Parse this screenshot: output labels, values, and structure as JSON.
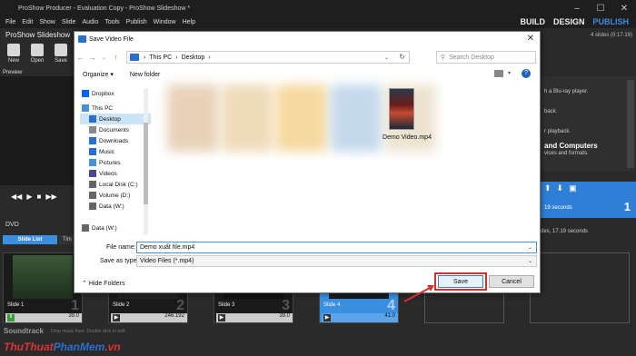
{
  "app": {
    "title": "ProShow Producer - Evaluation Copy - ProShow Slideshow *",
    "name": "ProShow Slideshow",
    "slide_info": "4 slides (0:17.19)",
    "menu": [
      "File",
      "Edit",
      "Show",
      "Slide",
      "Audio",
      "Tools",
      "Publish",
      "Window",
      "Help"
    ],
    "modes": [
      "BUILD",
      "DESIGN",
      "PUBLISH"
    ],
    "active_mode": "PUBLISH",
    "toolbar": [
      {
        "label": "New",
        "icon": "new-file-icon"
      },
      {
        "label": "Open",
        "icon": "open-folder-icon"
      },
      {
        "label": "Save",
        "icon": "save-disk-icon"
      }
    ],
    "preview_label": "Preview",
    "dvd_label": "DVD",
    "tab_slide_list": "Slide List",
    "tab_timeline": "Tim",
    "right_panel": {
      "line1": "h a Blu-ray player.",
      "line2": "back.",
      "line3": "r playback.",
      "heading": "and Computers",
      "line4": "vices and formats."
    },
    "blue_box_text": "19 seconds",
    "blue_box_num": "1",
    "slides_total": "des, 17.19 seconds",
    "slides": [
      {
        "label": "Slide 1",
        "num": "1",
        "duration": "39.0",
        "thumb_color": "#3c5a3a"
      },
      {
        "label": "Slide 2",
        "num": "2",
        "duration": "246.192",
        "thumb_color": "#2c2c2c"
      },
      {
        "label": "Slide 3",
        "num": "3",
        "duration": "39.0",
        "thumb_color": "#1e1e1e"
      },
      {
        "label": "Slide 4",
        "num": "4",
        "duration": "41.0",
        "thumb_color": "#20252d"
      }
    ],
    "soundtrack": "Soundtrack",
    "soundtrack_hint": "Drop music here. Double click to edit.",
    "watermark_a": "ThuThuat",
    "watermark_b": "PhanMem",
    "watermark_c": ".vn"
  },
  "dialog": {
    "title": "Save Video File",
    "path": [
      "This PC",
      "Desktop"
    ],
    "search_placeholder": "Search Desktop",
    "organize": "Organize",
    "new_folder": "New folder",
    "nav_items": [
      {
        "label": "Dropbox",
        "icon": "dropbox-icon",
        "color": "#0061fe"
      },
      {
        "label": "This PC",
        "icon": "computer-icon",
        "color": "#4a90d9"
      },
      {
        "label": "Desktop",
        "icon": "desktop-icon",
        "color": "#2a6fd0"
      },
      {
        "label": "Documents",
        "icon": "documents-icon",
        "color": "#8a8a8a"
      },
      {
        "label": "Downloads",
        "icon": "downloads-icon",
        "color": "#2a6fd0"
      },
      {
        "label": "Music",
        "icon": "music-icon",
        "color": "#2a6fd0"
      },
      {
        "label": "Pictures",
        "icon": "pictures-icon",
        "color": "#4a90d9"
      },
      {
        "label": "Videos",
        "icon": "videos-icon",
        "color": "#4a4a8a"
      },
      {
        "label": "Local Disk (C:)",
        "icon": "drive-icon",
        "color": "#666"
      },
      {
        "label": "Volume (D:)",
        "icon": "drive-icon",
        "color": "#666"
      },
      {
        "label": "Data (W:)",
        "icon": "drive-icon",
        "color": "#666"
      },
      {
        "label": "Data (W:)",
        "icon": "drive-icon",
        "color": "#666"
      }
    ],
    "selected_nav": "Desktop",
    "file": {
      "name": "Demo Video.mp4"
    },
    "file_name_label": "File name:",
    "file_name_value": "Demo xuất file.mp4",
    "save_type_label": "Save as type:",
    "save_type_value": "Video Files (*.mp4)",
    "hide_folders": "Hide Folders",
    "save": "Save",
    "cancel": "Cancel"
  },
  "colors": {
    "accent": "#3b8fe0",
    "highlight": "#d62d2d",
    "dialog_bg": "#ffffff"
  }
}
